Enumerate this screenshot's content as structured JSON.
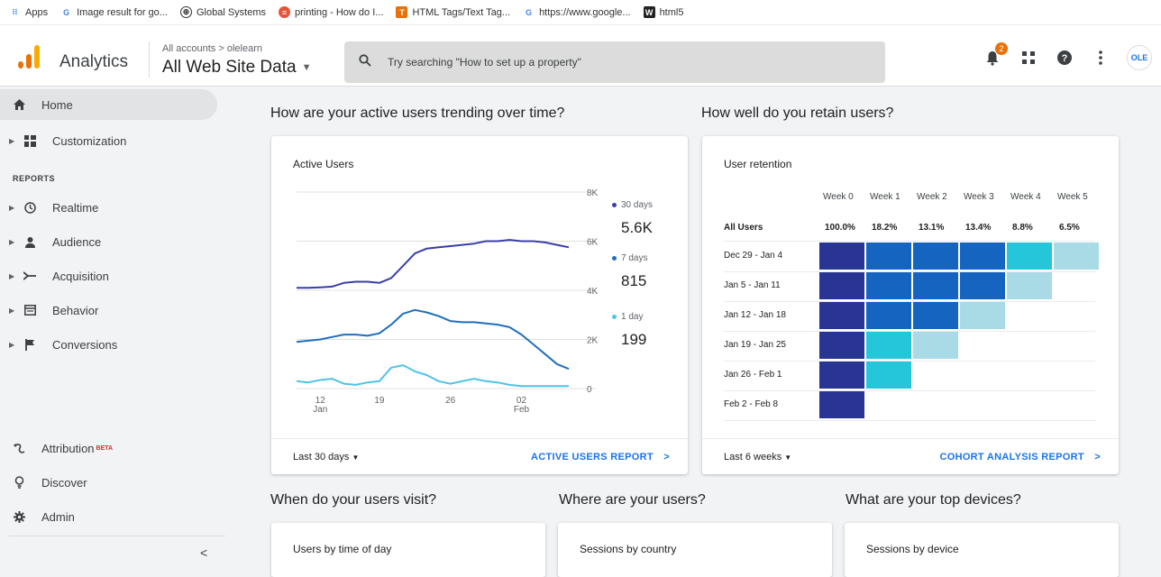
{
  "bookmarks": [
    {
      "label": "Apps",
      "icon": "apps-grid-icon"
    },
    {
      "label": "Image result for go...",
      "icon": "google-icon"
    },
    {
      "label": "Global Systems",
      "icon": "globe-icon"
    },
    {
      "label": "printing - How do I...",
      "icon": "stack-icon"
    },
    {
      "label": "HTML Tags/Text Tag...",
      "icon": "t-icon"
    },
    {
      "label": "https://www.google...",
      "icon": "google-icon"
    },
    {
      "label": "html5",
      "icon": "w-icon"
    }
  ],
  "header": {
    "app_name": "Analytics",
    "breadcrumb": "All accounts > olelearn",
    "property": "All Web Site Data",
    "search_placeholder": "Try searching \"How to set up a property\"",
    "notification_count": "2",
    "avatar_text": "OLE"
  },
  "sidebar": {
    "home": "Home",
    "customization": "Customization",
    "reports_label": "REPORTS",
    "items": [
      "Realtime",
      "Audience",
      "Acquisition",
      "Behavior",
      "Conversions"
    ],
    "attribution": "Attribution",
    "beta": "BETA",
    "discover": "Discover",
    "admin": "Admin"
  },
  "sections": {
    "active_trend": "How are your active users trending over time?",
    "retain": "How well do you retain users?",
    "visit": "When do your users visit?",
    "where": "Where are your users?",
    "devices": "What are your top devices?"
  },
  "active_card": {
    "title": "Active Users",
    "footer_left": "Last 30 days",
    "footer_right": "ACTIVE USERS REPORT",
    "legend": [
      {
        "label": "30 days",
        "value": "5.6K",
        "color": "#3a3fa8"
      },
      {
        "label": "7 days",
        "value": "815",
        "color": "#1f6fbf"
      },
      {
        "label": "1 day",
        "value": "199",
        "color": "#4fc3e8"
      }
    ]
  },
  "chart_data": {
    "type": "line",
    "title": "Active Users",
    "x_tick_labels": [
      "12\nJan",
      "19",
      "26",
      "02\nFeb"
    ],
    "y_tick_labels": [
      "8K",
      "6K",
      "4K",
      "2K",
      "0"
    ],
    "ylim": [
      0,
      8000
    ],
    "series": [
      {
        "name": "30 days",
        "color": "#3a3fa8",
        "values": [
          4100,
          4100,
          4120,
          4150,
          4300,
          4350,
          4350,
          4300,
          4500,
          5000,
          5500,
          5700,
          5750,
          5800,
          5850,
          5900,
          6000,
          6000,
          6050,
          6000,
          6000,
          5950,
          5850,
          5750
        ]
      },
      {
        "name": "7 days",
        "color": "#1f6fbf",
        "values": [
          1900,
          1950,
          2000,
          2100,
          2200,
          2200,
          2150,
          2250,
          2600,
          3050,
          3200,
          3100,
          2950,
          2750,
          2700,
          2700,
          2650,
          2600,
          2500,
          2200,
          1800,
          1400,
          1000,
          800
        ]
      },
      {
        "name": "1 day",
        "color": "#4fc3e8",
        "values": [
          300,
          250,
          350,
          400,
          200,
          150,
          250,
          300,
          850,
          950,
          700,
          550,
          300,
          200,
          300,
          400,
          300,
          250,
          150,
          100,
          100,
          100,
          100,
          100
        ]
      }
    ]
  },
  "retention_card": {
    "title": "User retention",
    "footer_left": "Last 6 weeks",
    "footer_right": "COHORT ANALYSIS REPORT",
    "weeks": [
      "Week 0",
      "Week 1",
      "Week 2",
      "Week 3",
      "Week 4",
      "Week 5"
    ],
    "all_users_label": "All Users",
    "all_users": [
      "100.0%",
      "18.2%",
      "13.1%",
      "13.4%",
      "8.8%",
      "6.5%"
    ],
    "cohorts": [
      {
        "label": "Dec 29 - Jan 4",
        "levels": [
          1.0,
          0.2,
          0.2,
          0.2,
          0.6,
          0.8
        ]
      },
      {
        "label": "Jan 5 - Jan 11",
        "levels": [
          1.0,
          0.2,
          0.2,
          0.2,
          0.8
        ]
      },
      {
        "label": "Jan 12 - Jan 18",
        "levels": [
          1.0,
          0.2,
          0.2,
          0.8
        ]
      },
      {
        "label": "Jan 19 - Jan 25",
        "levels": [
          1.0,
          0.6,
          0.8
        ]
      },
      {
        "label": "Jan 26 - Feb 1",
        "levels": [
          1.0,
          0.6
        ]
      },
      {
        "label": "Feb 2 - Feb 8",
        "levels": [
          1.0
        ]
      }
    ]
  },
  "bottom_cards": {
    "time_of_day": "Users by time of day",
    "country": "Sessions by country",
    "device": "Sessions by device"
  }
}
